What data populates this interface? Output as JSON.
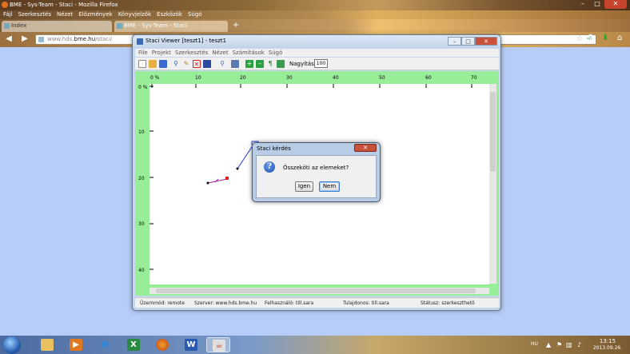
{
  "firefox": {
    "title": "BME - Sys-Team - Staci - Mozilla Firefox",
    "window_buttons": [
      "–",
      "□",
      "✕"
    ],
    "menu": [
      "Fájl",
      "Szerkesztés",
      "Nézet",
      "Előzmények",
      "Könyvjelzők",
      "Eszközök",
      "Súgó"
    ],
    "tabs": [
      {
        "label": "Index"
      },
      {
        "label": "BME - Sys-Team - Staci"
      }
    ],
    "new_tab": "+",
    "url_prefix": "www.hds.",
    "url_domain": "bme.hu",
    "url_path": "/staci/"
  },
  "staci": {
    "title": "Staci Viewer [teszt1] - teszt1",
    "window_buttons": [
      "–",
      "□",
      "✕"
    ],
    "menu": [
      "File",
      "Projekt",
      "Szerkesztés",
      "Nézet",
      "Számítások",
      "Súgó"
    ],
    "zoom_label": "Nagyítás:",
    "zoom_value": "100",
    "ruler": {
      "x_ticks": [
        "0 %",
        "10",
        "20",
        "30",
        "40",
        "50",
        "60",
        "70"
      ],
      "y_ticks": [
        "0 %",
        "10",
        "20",
        "30",
        "40"
      ]
    },
    "status": {
      "mode": "Üzemmód: remote",
      "server": "Szerver: www.hds.bme.hu",
      "user": "Felhasználó: till.sara",
      "owner": "Tulajdonos: till.sara",
      "state": "Státusz: szerkeszthető"
    }
  },
  "dialog": {
    "title": "Staci kérdés",
    "close": "✕",
    "question_icon": "?",
    "message": "Összeköti az elemeket?",
    "yes": "Igen",
    "no": "Nem"
  },
  "taskbar": {
    "language": "HU",
    "time": "13:15",
    "date": "2013.09.26."
  }
}
